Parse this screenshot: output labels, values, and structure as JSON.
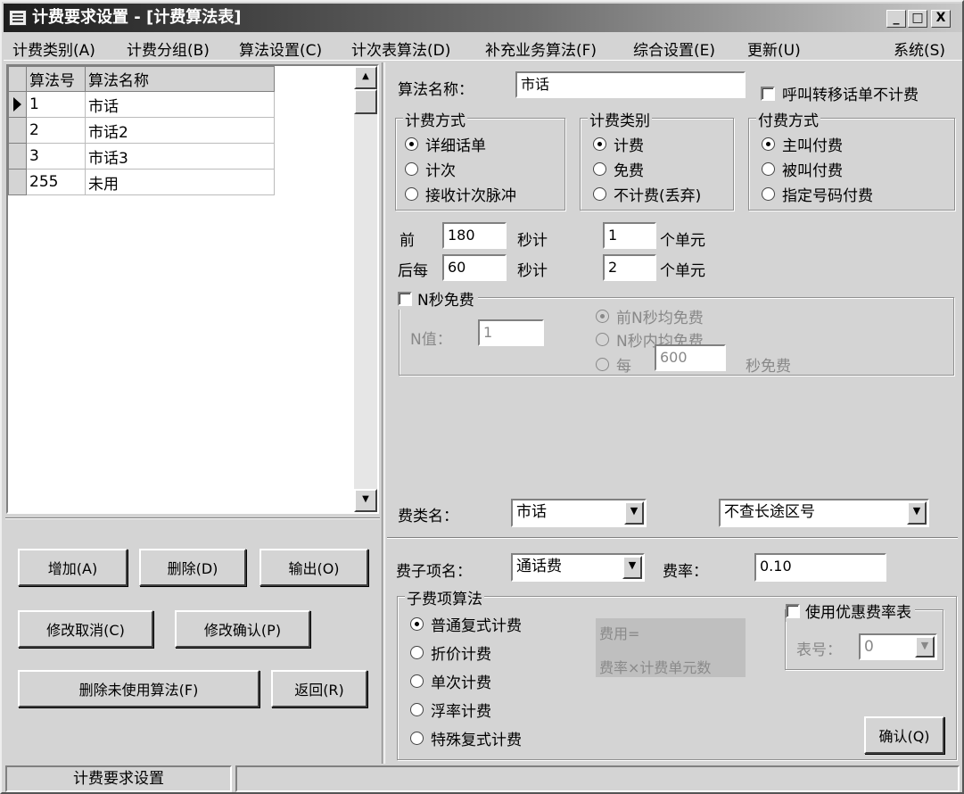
{
  "window": {
    "title": "计费要求设置 - [计费算法表]",
    "min": "_",
    "max": "□",
    "close": "X"
  },
  "menu": [
    "计费类别(A)",
    "计费分组(B)",
    "算法设置(C)",
    "计次表算法(D)",
    "补充业务算法(F)",
    "综合设置(E)",
    "更新(U)",
    "系统(S)"
  ],
  "grid": {
    "headers": [
      "算法号",
      "算法名称"
    ],
    "rows": [
      [
        "1",
        "市话"
      ],
      [
        "2",
        "市话2"
      ],
      [
        "3",
        "市话3"
      ],
      [
        "255",
        "未用"
      ]
    ],
    "current_row": 0
  },
  "buttons": {
    "add": "增加(A)",
    "delete": "删除(D)",
    "export": "输出(O)",
    "cancel_edit": "修改取消(C)",
    "confirm_edit": "修改确认(P)",
    "delete_unused": "删除未使用算法(F)",
    "back": "返回(R)",
    "confirm": "确认(Q)"
  },
  "form": {
    "name_label": "算法名称：",
    "name_value": "市话",
    "transfer_label": "呼叫转移话单不计费",
    "transfer_checked": false,
    "billing_mode": {
      "title": "计费方式",
      "options": [
        "详细话单",
        "计次",
        "接收计次脉冲"
      ],
      "selected": 0
    },
    "billing_category": {
      "title": "计费类别",
      "options": [
        "计费",
        "免费",
        "不计费(丢弃)"
      ],
      "selected": 0
    },
    "payment": {
      "title": "付费方式",
      "options": [
        "主叫付费",
        "被叫付费",
        "指定号码付费"
      ],
      "selected": 0
    },
    "first_label": "前",
    "first_secs": "180",
    "sec_unit_label": "秒计",
    "first_units": "1",
    "units_label": "个单元",
    "after_label": "后每",
    "after_secs": "60",
    "after_units": "2",
    "nfree": {
      "title": "N秒免费",
      "checked": false,
      "n_label": "N值：",
      "n_value": "1",
      "opt1": "前N秒均免费",
      "opt2": "N秒内均免费",
      "opt3_prefix": "每",
      "opt3_value": "600",
      "opt3_suffix": "秒免费",
      "selected": 0
    },
    "fee_class_label": "费类名：",
    "fee_class_value": "市话",
    "long_distance_value": "不查长途区号",
    "sub_item_label": "费子项名：",
    "sub_item_value": "通话费",
    "rate_label": "费率：",
    "rate_value": "0.10",
    "sub_algo": {
      "title": "子费项算法",
      "options": [
        "普通复式计费",
        "折价计费",
        "单次计费",
        "浮率计费",
        "特殊复式计费"
      ],
      "selected": 0
    },
    "formula_line1": "费用=",
    "formula_line2": "费率×计费单元数",
    "discount": {
      "title": "使用优惠费率表",
      "checked": false,
      "table_label": "表号：",
      "table_value": "0"
    }
  },
  "status": {
    "text": "计费要求设置"
  }
}
